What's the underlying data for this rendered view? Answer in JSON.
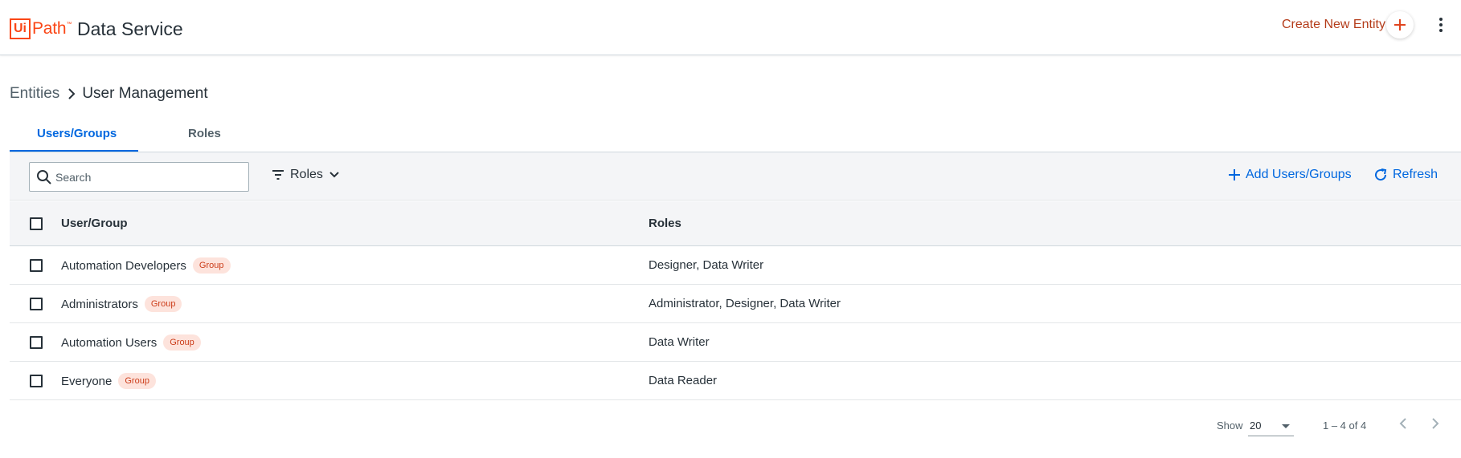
{
  "header": {
    "logo_box": "Ui",
    "logo_path": "Path",
    "logo_tm": "™",
    "app_title": "Data Service",
    "create_entity_label": "Create New Entity"
  },
  "breadcrumb": {
    "root": "Entities",
    "current": "User Management"
  },
  "tabs": [
    {
      "label": "Users/Groups",
      "active": true
    },
    {
      "label": "Roles",
      "active": false
    }
  ],
  "toolbar": {
    "search_placeholder": "Search",
    "roles_filter_label": "Roles",
    "add_label": "Add Users/Groups",
    "refresh_label": "Refresh"
  },
  "table": {
    "columns": [
      "User/Group",
      "Roles"
    ],
    "rows": [
      {
        "name": "Automation Developers",
        "badge": "Group",
        "roles": "Designer, Data Writer"
      },
      {
        "name": "Administrators",
        "badge": "Group",
        "roles": "Administrator, Designer, Data Writer"
      },
      {
        "name": "Automation Users",
        "badge": "Group",
        "roles": "Data Writer"
      },
      {
        "name": "Everyone",
        "badge": "Group",
        "roles": "Data Reader"
      }
    ]
  },
  "pagination": {
    "show_label": "Show",
    "page_size": "20",
    "range": "1 – 4 of 4"
  },
  "colors": {
    "brand": "#fa4616",
    "accent": "#0067df",
    "badge_bg": "#fde3dc",
    "badge_text": "#cc3d1a"
  }
}
